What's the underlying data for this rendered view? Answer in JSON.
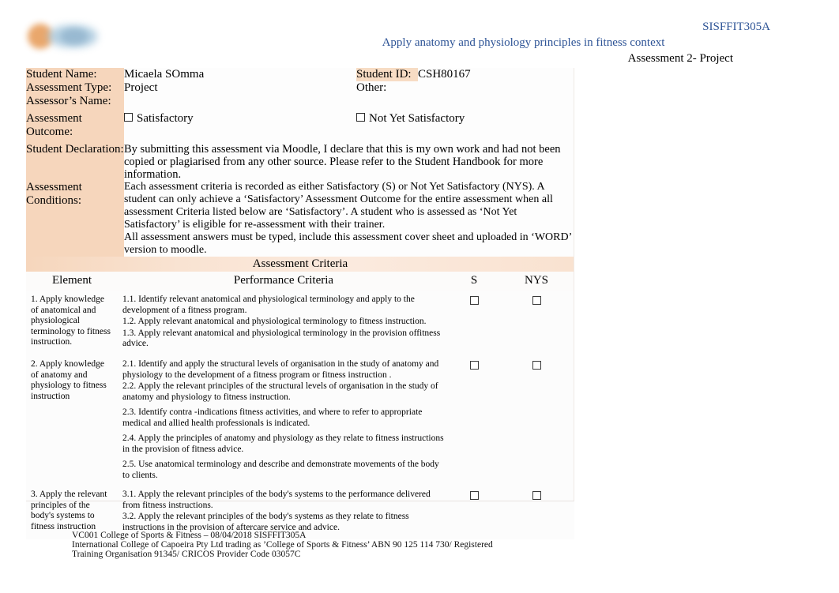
{
  "header": {
    "unit_code": "SISFFIT305A",
    "unit_title": "Apply anatomy and physiology principles in fitness context",
    "assessment_label": "Assessment 2- Project",
    "logo_name": "college-logo"
  },
  "cover": {
    "student_name_label": "Student Name:",
    "student_name_value": "Micaela SOmma",
    "student_id_label": "Student ID:",
    "student_id_value": "CSH80167",
    "assessment_type_label": "Assessment Type:",
    "assessment_type_value": "Project",
    "other_label": "Other:",
    "other_value": "",
    "assessor_name_label": "Assessor’s Name:",
    "assessor_name_value": "",
    "assessment_outcome_label": "Assessment Outcome:",
    "outcome_satisfactory": "Satisfactory",
    "outcome_not_yet_satisfactory": "Not Yet Satisfactory",
    "student_declaration_label": "Student Declaration:",
    "student_declaration_text": "By submitting this assessment via Moodle, I declare that this is my own work and had not been copied or plagiarised from any other source. Please refer to the Student Handbook for more information.",
    "assessment_conditions_label": "Assessment Conditions:",
    "assessment_conditions_p1": "Each assessment criteria is recorded as either Satisfactory (S) or Not Yet Satisfactory (NYS). A student can only achieve a ‘Satisfactory’ Assessment Outcome for the entire assessment when all assessment Criteria listed below are ‘Satisfactory’. A student who is assessed as ‘Not Yet Satisfactory’ is eligible for re-assessment with their trainer.",
    "assessment_conditions_p2": "All assessment answers must be typed, include this assessment cover sheet and uploaded in ‘WORD’ version to moodle."
  },
  "criteria": {
    "banner_title": "Assessment Criteria",
    "columns": {
      "element": "Element",
      "performance": "Performance Criteria",
      "s": "S",
      "nys": "NYS"
    },
    "rows": [
      {
        "element": "1. Apply knowledge of anatomical and physiological terminology to fitness instruction.",
        "items": [
          "1.1. Identify relevant anatomical and physiological terminology and apply to the development of a fitness program.",
          "1.2. Apply relevant anatomical and physiological terminology to fitness instruction.",
          "1.3. Apply relevant anatomical and physiological terminology in the provision offitness advice."
        ]
      },
      {
        "element": "2. Apply knowledge of anatomy and physiology to fitness instruction",
        "items": [
          "2.1. Identify and apply the structural levels of organisation  in the study of anatomy and physiology to the development of a  fitness program or fitness instruction .",
          "2.2. Apply the relevant principles of the structural levels of organisation in the study of anatomy and physiology to fitness instruction.",
          "2.3. Identify contra -indications  fitness activities, and where to refer to appropriate  medical and allied health professionals  is indicated.",
          "2.4. Apply the principles of anatomy and physiology as they relate to fitness instructions in the provision of fitness advice.",
          "2.5. Use anatomical terminology  and describe and demonstrate movements of the body to clients."
        ]
      },
      {
        "element": "3. Apply the relevant principles of the body's systems to fitness instruction",
        "items": [
          "3.1. Apply the relevant principles of the body's systems to the performance delivered from fitness instructions.",
          "3.2. Apply the relevant principles of the body's systems as they relate to fitness instructions in the provision of aftercare service and advice."
        ]
      }
    ]
  },
  "footer": {
    "line1": "VC001 College of Sports & Fitness – 08/04/2018 SISFFIT305A",
    "line2": "International College of Capoeira Pty Ltd trading as ’College of Sports & Fitness’ ABN 90 125 114 730/ Registered",
    "line3": "Training Organisation 91345/ CRICOS Provider Code 03057C"
  },
  "colors": {
    "label_bg": "#f6d6bc",
    "banner_accent": "#f9e3d2",
    "header_blue": "#2e5496",
    "logo_orange": "#e8a060",
    "logo_blue": "#a8c8dd"
  }
}
